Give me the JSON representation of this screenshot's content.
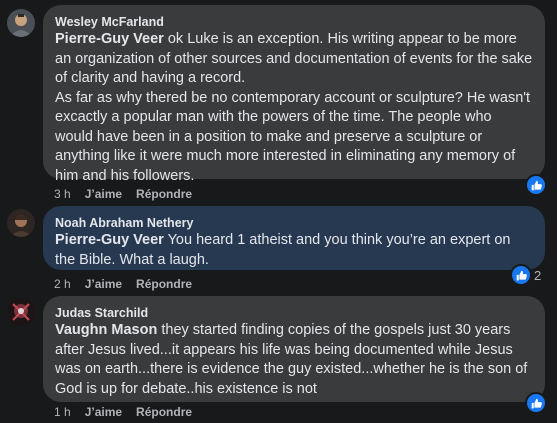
{
  "comments": [
    {
      "author": "Wesley McFarland",
      "mention": "Pierre-Guy Veer",
      "text": " ok Luke is an exception. His writing appear to be more an organization of other sources and documentation of events for the sake of clarity and having a record.",
      "text2": "As far as why thered be no contemporary account or sculpture? He wasn't excactly a popular man with the powers of the time. The people who would have been in a position to make and preserve a sculpture or anything like it were much more interested in eliminating any memory of him and his followers.",
      "time": "3 h",
      "like_label": "J’aime",
      "reply_label": "Répondre"
    },
    {
      "author": "Noah Abraham Nethery",
      "mention": "Pierre-Guy Veer",
      "text": " You heard 1 atheist and you think you’re an expert on the Bible. What a laugh.",
      "time": "2 h",
      "like_label": "J’aime",
      "reply_label": "Répondre",
      "reaction_count": "2"
    },
    {
      "author": "Judas Starchild",
      "mention": "Vaughn Mason",
      "text": " they started finding copies of the gospels just 30 years after Jesus lived...it appears his life was being documented while Jesus was on earth...there is evidence the guy existed...whether he is the son of God is up for debate..his existence is not",
      "time": "1 h",
      "like_label": "J’aime",
      "reply_label": "Répondre"
    }
  ],
  "icons": {
    "reaction": "thumbs-up-icon"
  },
  "colors": {
    "like_blue": "#1877f2",
    "bubble_gray": "#3a3b3c",
    "bubble_highlight": "#263951"
  }
}
